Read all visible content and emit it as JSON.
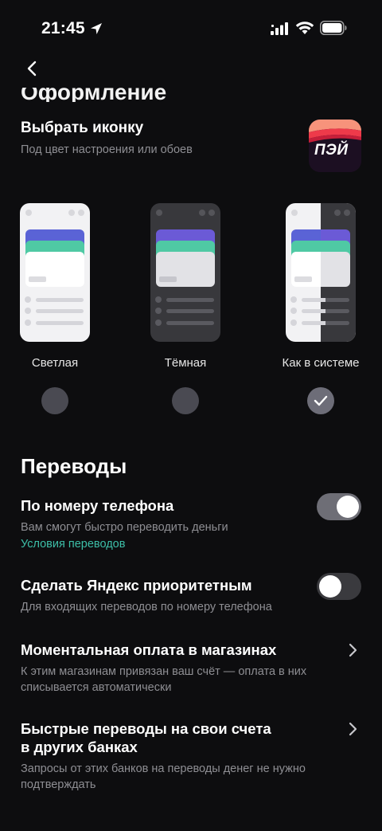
{
  "status_bar": {
    "time": "21:45"
  },
  "header": {
    "section_title": "Оформление"
  },
  "icon_setting": {
    "title": "Выбрать иконку",
    "subtitle": "Под цвет настроения или обоев",
    "app_icon_text": "ПЭЙ"
  },
  "themes": [
    {
      "label": "Светлая",
      "selected": false
    },
    {
      "label": "Тёмная",
      "selected": false
    },
    {
      "label": "Как в системе",
      "selected": true
    }
  ],
  "transfers": {
    "title": "Переводы",
    "by_phone": {
      "title": "По номеру телефона",
      "desc": "Вам смогут быстро переводить деньги",
      "link": "Условия переводов",
      "enabled": true
    },
    "priority": {
      "title": "Сделать Яндекс приоритетным",
      "desc": "Для входящих переводов по номеру телефона",
      "enabled": false
    },
    "instant_pay": {
      "title": "Моментальная оплата в магазинах",
      "desc_line1": "К этим магазинам привязан ваш счёт — оплата в них",
      "desc_line2": "списывается автоматически"
    },
    "fast_transfers": {
      "title_line1": "Быстрые переводы на свои счета",
      "title_line2": "в других банках",
      "desc_line1": "Запросы от этих банков на переводы денег не нужно",
      "desc_line2": "подтверждать"
    }
  },
  "colors": {
    "background": "#0d0d0f",
    "link": "#3dbfa8",
    "toggle_on": "#6e6e76",
    "toggle_off": "#3a3a3e",
    "secondary_text": "#8e8e93"
  }
}
